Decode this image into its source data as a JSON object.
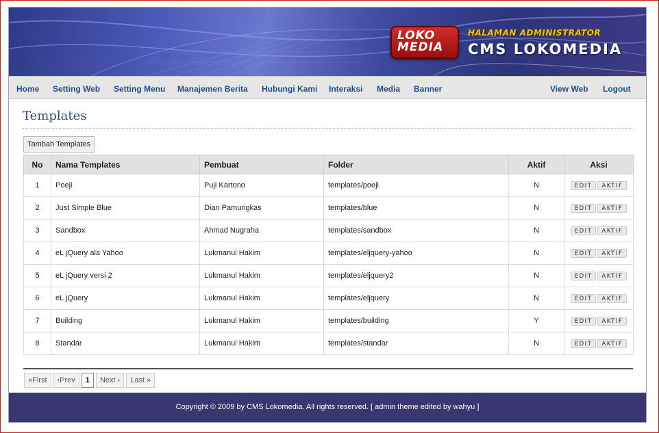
{
  "header": {
    "logo_line1": "LOKO",
    "logo_line2": "MEDIA",
    "subtitle": "HALAMAN ADMINISTRATOR",
    "title": "CMS LOKOMEDIA"
  },
  "nav": {
    "left": [
      "Home",
      "Setting Web",
      "Setting Menu",
      "Manajemen Berita",
      "Hubungi Kami",
      "Interaksi",
      "Media",
      "Banner"
    ],
    "right": [
      "View Web",
      "Logout"
    ]
  },
  "page": {
    "title": "Templates",
    "add_button": "Tambah Templates"
  },
  "table": {
    "headers": [
      "No",
      "Nama Templates",
      "Pembuat",
      "Folder",
      "Aktif",
      "Aksi"
    ],
    "edit_label": "EDIT",
    "aktif_label": "AKTIF",
    "rows": [
      {
        "no": "1",
        "nama": "Poeji",
        "pembuat": "Puji Kartono",
        "folder": "templates/poeji",
        "aktif": "N"
      },
      {
        "no": "2",
        "nama": "Just Simple Blue",
        "pembuat": "Dian Pamungkas",
        "folder": "templates/blue",
        "aktif": "N"
      },
      {
        "no": "3",
        "nama": "Sandbox",
        "pembuat": "Ahmad Nugraha",
        "folder": "templates/sandbox",
        "aktif": "N"
      },
      {
        "no": "4",
        "nama": "eL jQuery ala Yahoo",
        "pembuat": "Lukmanul Hakim",
        "folder": "templates/eljquery-yahoo",
        "aktif": "N"
      },
      {
        "no": "5",
        "nama": "eL jQuery versi 2",
        "pembuat": "Lukmanul Hakim",
        "folder": "templates/eljquery2",
        "aktif": "N"
      },
      {
        "no": "6",
        "nama": "eL jQuery",
        "pembuat": "Lukmanul Hakim",
        "folder": "templates/eljquery",
        "aktif": "N"
      },
      {
        "no": "7",
        "nama": "Building",
        "pembuat": "Lukmanul Hakim",
        "folder": "templates/building",
        "aktif": "Y"
      },
      {
        "no": "8",
        "nama": "Standar",
        "pembuat": "Lukmanul Hakim",
        "folder": "templates/standar",
        "aktif": "N"
      }
    ]
  },
  "pager": {
    "first": "«First",
    "prev": "‹Prev",
    "current": "1",
    "next": "Next ›",
    "last": "Last »"
  },
  "footer": {
    "text": "Copyright © 2009 by CMS Lokomedia. All rights reserved. [ admin theme edited by wahyu ]"
  },
  "colors": {
    "nav_link": "#1f4e8f",
    "page_title": "#2d4f7d",
    "footer_bg": "#3a3672",
    "header_accent": "#f2c200",
    "logo_red": "#c62323",
    "frame_border": "#c41d1d"
  }
}
